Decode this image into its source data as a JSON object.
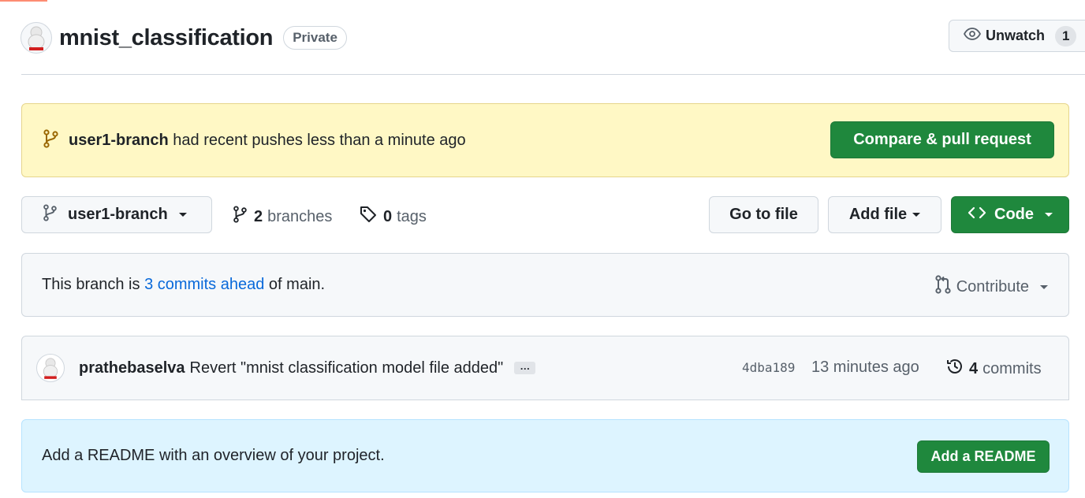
{
  "repo": {
    "name": "mnist_classification",
    "visibility": "Private"
  },
  "watch": {
    "label": "Unwatch",
    "count": "1"
  },
  "push_banner": {
    "branch": "user1-branch",
    "message": "had recent pushes less than a minute ago",
    "button": "Compare & pull request"
  },
  "file_nav": {
    "current_branch": "user1-branch",
    "branches_count": "2",
    "branches_label": "branches",
    "tags_count": "0",
    "tags_label": "tags",
    "go_to_file": "Go to file",
    "add_file": "Add file",
    "code": "Code"
  },
  "ahead": {
    "prefix": "This branch is",
    "link": "3 commits ahead",
    "suffix": "of main.",
    "contribute": "Contribute"
  },
  "latest_commit": {
    "author": "prathebaselva",
    "message": "Revert \"mnist classification model file added\"",
    "ellipsis": "…",
    "sha": "4dba189",
    "time": "13 minutes ago",
    "commits_count": "4",
    "commits_label": "commits"
  },
  "readme": {
    "message": "Add a README with an overview of your project.",
    "button": "Add a README"
  },
  "colors": {
    "accent_green": "#1f883d",
    "link_blue": "#0969da",
    "banner_yellow": "#fff8c5",
    "banner_blue": "#ddf4ff"
  }
}
